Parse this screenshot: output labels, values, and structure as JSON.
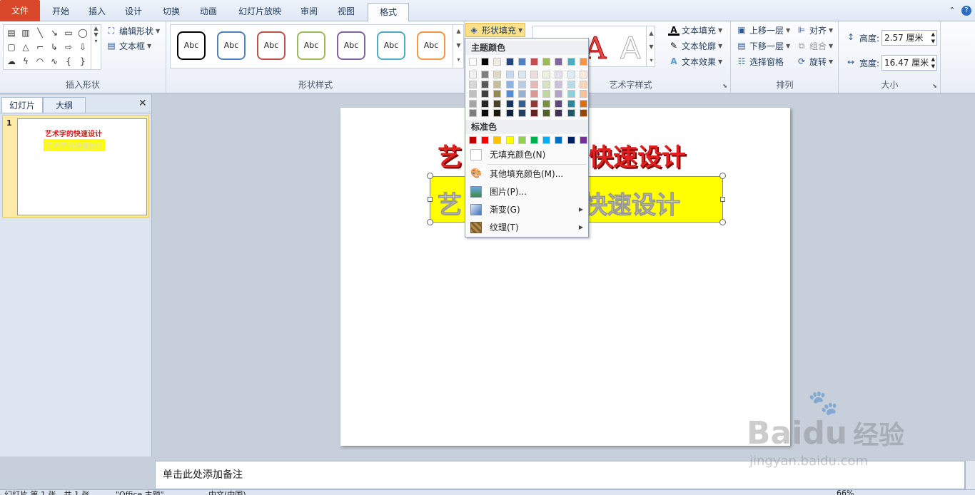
{
  "tabs": [
    {
      "label": "文件"
    },
    {
      "label": "开始"
    },
    {
      "label": "插入"
    },
    {
      "label": "设计"
    },
    {
      "label": "切换"
    },
    {
      "label": "动画"
    },
    {
      "label": "幻灯片放映"
    },
    {
      "label": "审阅"
    },
    {
      "label": "视图"
    },
    {
      "label": "格式"
    }
  ],
  "ribbon": {
    "insert_shapes": {
      "edit_shape": "编辑形状",
      "text_box": "文本框",
      "label": "插入形状"
    },
    "shape_styles": {
      "abc": "Abc",
      "label": "形状样式",
      "fill": "形状填充"
    },
    "wordart": {
      "text_fill": "文本填充",
      "text_outline": "文本轮廓",
      "text_effect": "文本效果",
      "label": "艺术字样式"
    },
    "arrange": {
      "bring_forward": "上移一层",
      "send_backward": "下移一层",
      "selection_pane": "选择窗格",
      "align": "对齐",
      "group": "组合",
      "rotate": "旋转",
      "label": "排列"
    },
    "size": {
      "height_label": "高度:",
      "height_value": "2.57 厘米",
      "width_label": "宽度:",
      "width_value": "16.47 厘米",
      "label": "大小"
    }
  },
  "left_pane": {
    "tab_slides": "幻灯片",
    "tab_outline": "大纲",
    "slide_number": "1",
    "thumb_title": "艺术字的快速设计",
    "thumb_sub": "艺术字的快速设计"
  },
  "slide": {
    "title_left": "艺",
    "title_right": "快速设计",
    "box_text_left": "艺",
    "box_text_right": "快速设计"
  },
  "notes": {
    "placeholder": "单击此处添加备注"
  },
  "statusbar": {
    "slide_info": "幻灯片 第 1 张，共 1 张",
    "theme": "\"Office 主题\"",
    "language": "中文(中国)",
    "zoom": "66%"
  },
  "dropdown": {
    "theme_colors_label": "主题颜色",
    "standard_colors_label": "标准色",
    "no_fill": "无填充颜色(N)",
    "more_colors": "其他填充颜色(M)...",
    "picture": "图片(P)...",
    "gradient": "渐变(G)",
    "texture": "纹理(T)",
    "theme_top": [
      "#ffffff",
      "#000000",
      "#eeece1",
      "#1f497d",
      "#4f81bd",
      "#c0504d",
      "#9bbb59",
      "#8064a2",
      "#4bacc6",
      "#f79646"
    ],
    "theme_shades": [
      [
        "#f2f2f2",
        "#7f7f7f",
        "#ddd9c3",
        "#c6d9f0",
        "#dbe5f1",
        "#f2dcdb",
        "#ebf1dd",
        "#e5e0ec",
        "#dbeef3",
        "#fdeada"
      ],
      [
        "#d8d8d8",
        "#595959",
        "#c4bd97",
        "#8db3e2",
        "#b8cce4",
        "#e5b9b7",
        "#d7e3bc",
        "#ccc1d9",
        "#b7dde8",
        "#fbd5b5"
      ],
      [
        "#bfbfbf",
        "#3f3f3f",
        "#938953",
        "#548dd4",
        "#95b3d7",
        "#d99694",
        "#c3d69b",
        "#b2a2c7",
        "#92cddc",
        "#fac08f"
      ],
      [
        "#a5a5a5",
        "#262626",
        "#494429",
        "#17365d",
        "#366092",
        "#953734",
        "#76923c",
        "#5f497a",
        "#31859b",
        "#e36c09"
      ],
      [
        "#7f7f7f",
        "#0c0c0c",
        "#1d1b10",
        "#0f243e",
        "#244061",
        "#632423",
        "#4f6128",
        "#3f3151",
        "#205867",
        "#974806"
      ]
    ],
    "standard": [
      "#c00000",
      "#ff0000",
      "#ffc000",
      "#ffff00",
      "#92d050",
      "#00b050",
      "#00b0f0",
      "#0070c0",
      "#002060",
      "#7030a0"
    ]
  },
  "watermark": {
    "brand": "Bai",
    "brand2": "du",
    "brand3": "经验",
    "url": "jingyan.baidu.com"
  }
}
